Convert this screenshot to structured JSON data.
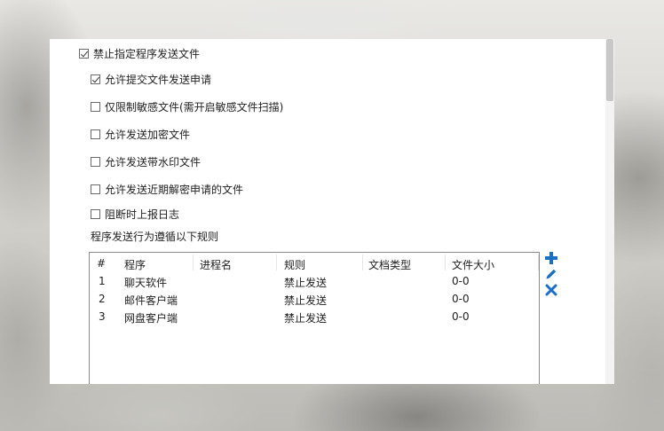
{
  "options": {
    "main": {
      "label": "禁止指定程序发送文件",
      "checked": true
    },
    "allow_submit": {
      "label": "允许提交文件发送申请",
      "checked": true
    },
    "sensitive_only": {
      "label": "仅限制敏感文件(需开启敏感文件扫描)",
      "checked": false
    },
    "allow_encrypted": {
      "label": "允许发送加密文件",
      "checked": false
    },
    "allow_watermark": {
      "label": "允许发送带水印文件",
      "checked": false
    },
    "allow_recent_decrypt": {
      "label": "允许发送近期解密申请的文件",
      "checked": false
    },
    "report_log": {
      "label": "阻断时上报日志",
      "checked": false
    }
  },
  "rules_section_label": "程序发送行为遵循以下规则",
  "table": {
    "headers": [
      "#",
      "程序",
      "进程名",
      "规则",
      "文档类型",
      "文件大小"
    ],
    "rows": [
      [
        "1",
        "聊天软件",
        "",
        "禁止发送",
        "",
        "0-0"
      ],
      [
        "2",
        "邮件客户端",
        "",
        "禁止发送",
        "",
        "0-0"
      ],
      [
        "3",
        "网盘客户端",
        "",
        "禁止发送",
        "",
        "0-0"
      ]
    ]
  },
  "side_actions": {
    "add_icon": "plus-icon",
    "edit_icon": "pencil-icon",
    "delete_icon": "x-icon",
    "accent_color": "#1b6fc4"
  }
}
